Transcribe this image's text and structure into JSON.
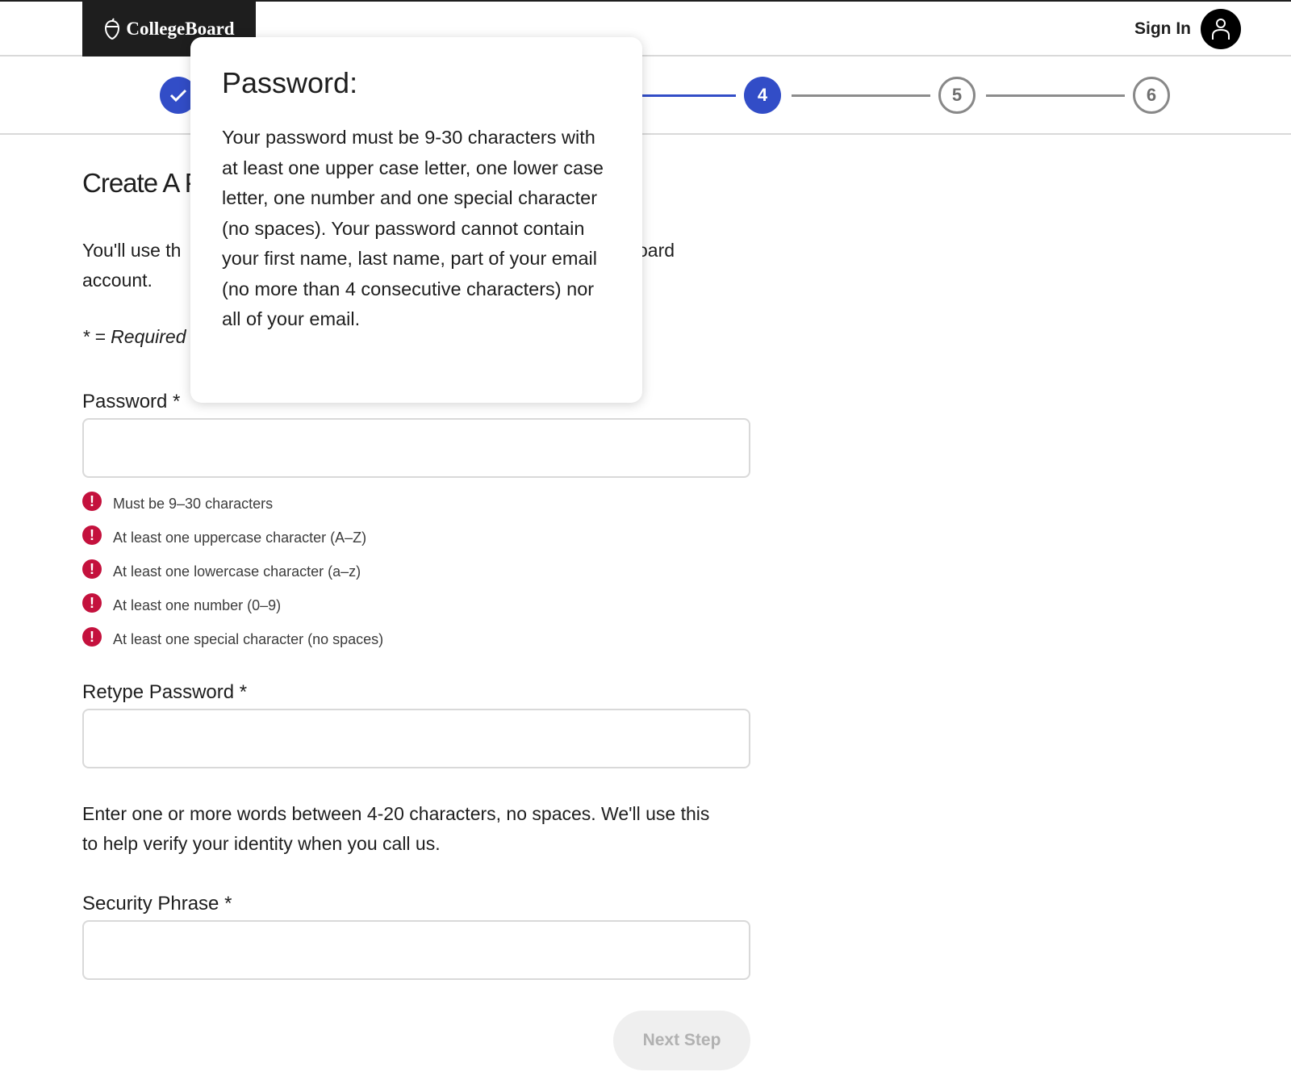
{
  "header": {
    "logo_text": "CollegeBoard",
    "sign_in_label": "Sign In",
    "logo_icon": "acorn-icon",
    "avatar_icon": "user-icon"
  },
  "stepper": {
    "steps": [
      {
        "label": "",
        "state": "completed"
      },
      {
        "label": "4",
        "state": "current"
      },
      {
        "label": "5",
        "state": "upcoming"
      },
      {
        "label": "6",
        "state": "upcoming"
      }
    ],
    "accent_color": "#324dc7"
  },
  "main": {
    "title_visible": "Create A P",
    "intro_line1_left": "You'll use th",
    "intro_line1_right": "oard",
    "intro_line2": "account.",
    "required_note": "* = Required"
  },
  "password": {
    "label": "Password *",
    "value": "",
    "rules": [
      "Must be 9–30 characters",
      "At least one uppercase character (A–Z)",
      "At least one lowercase character (a–z)",
      "At least one number (0–9)",
      "At least one special character (no spaces)"
    ],
    "rule_status_color": "#c4113d"
  },
  "retype_password": {
    "label": "Retype Password *",
    "value": ""
  },
  "security_phrase": {
    "hint": "Enter one or more words between 4-20 characters, no spaces. We'll use this to help verify your identity when you call us.",
    "label": "Security Phrase *",
    "value": ""
  },
  "actions": {
    "next_label": "Next Step"
  },
  "tooltip": {
    "title": "Password:",
    "body": "Your password must be 9-30 characters with at least one upper case letter, one lower case letter, one number and one special character (no spaces). Your password cannot contain your first name, last name, part of your email (no more than 4 consecutive characters) nor all of your email."
  }
}
